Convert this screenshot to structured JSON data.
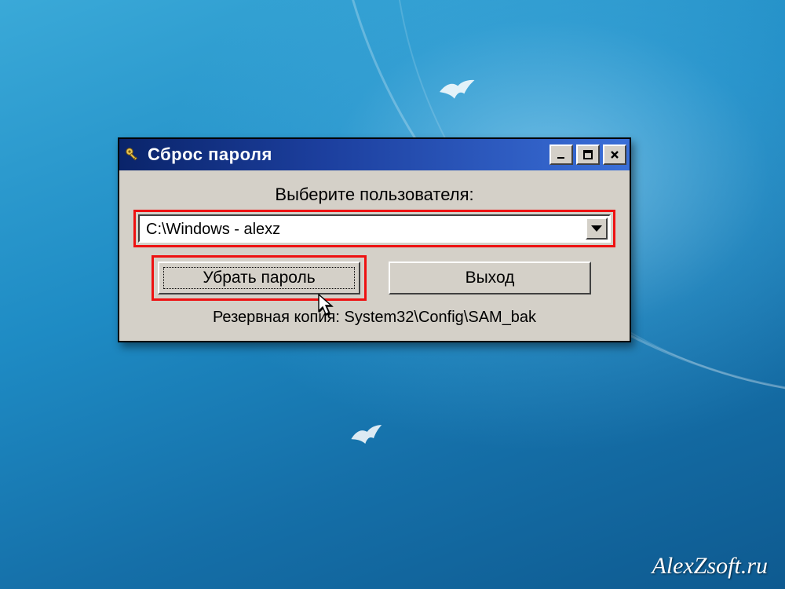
{
  "window": {
    "title": "Сброс пароля",
    "select_user_label": "Выберите пользователя:",
    "dropdown_value": "C:\\Windows - alexz",
    "remove_password_label": "Убрать пароль",
    "exit_label": "Выход",
    "backup_label": "Резервная копия: System32\\Config\\SAM_bak"
  },
  "watermark": "AlexZsoft.ru"
}
